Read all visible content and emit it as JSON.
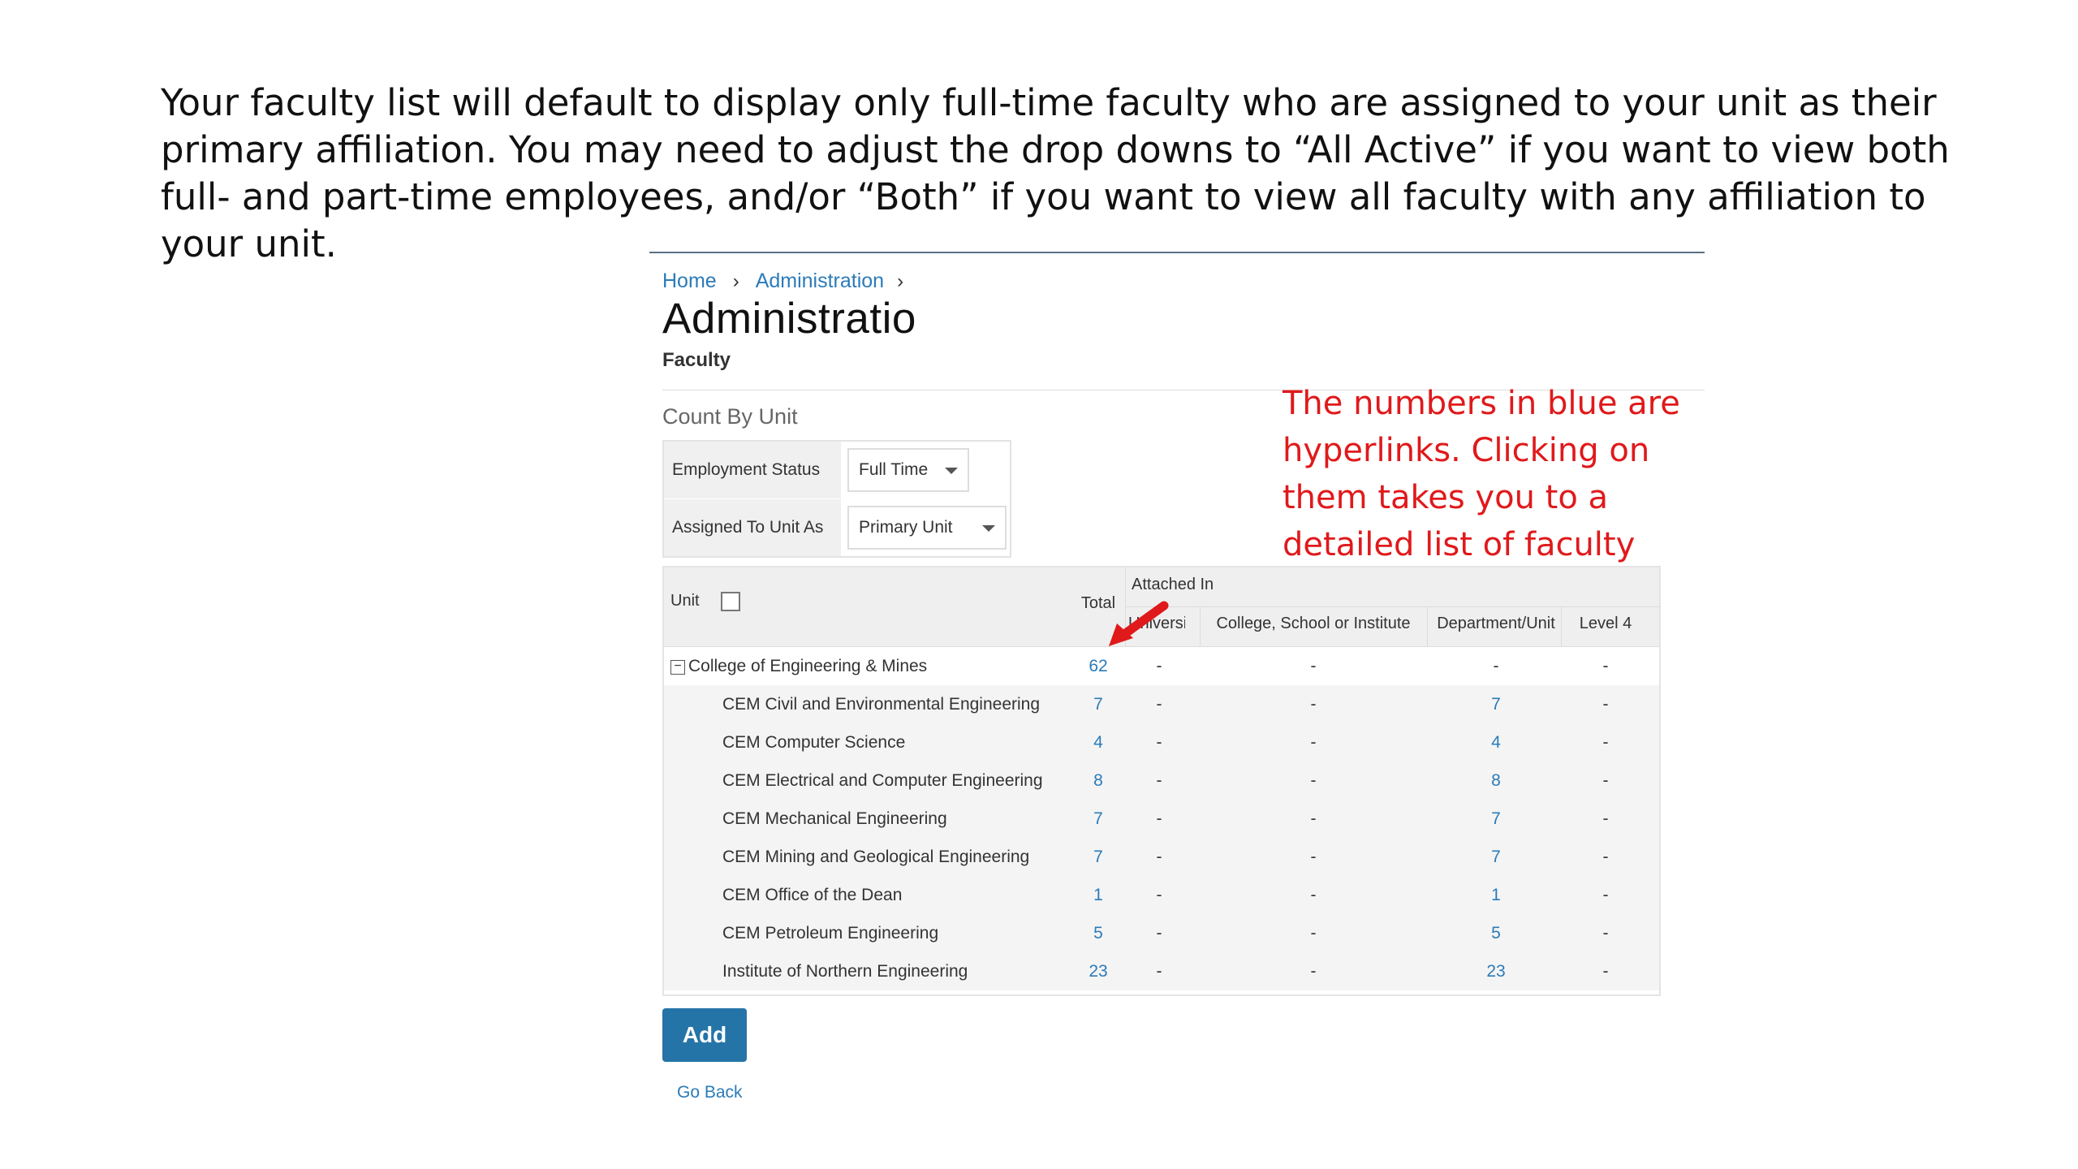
{
  "intro_text": "Your faculty list will default to display only full-time faculty who are assigned to your unit as their primary affiliation.  You may need to adjust the drop downs to “All Active” if you want to view both full- and part-time employees, and/or “Both” if you want to view all faculty with any affiliation to your unit.",
  "breadcrumb": {
    "home": "Home",
    "administration": "Administration",
    "sep": "›"
  },
  "page_title": "Administratio",
  "page_subtitle": "Faculty",
  "count_title": "Count By Unit",
  "filters": {
    "employment_status_label": "Employment Status",
    "employment_status_value": "Full Time",
    "assigned_label": "Assigned To Unit As",
    "assigned_value": "Primary Unit"
  },
  "table": {
    "headers": {
      "unit": "Unit",
      "total": "Total",
      "attached_in": "Attached In",
      "university": "University",
      "college": "College, School or Institute",
      "department": "Department/Unit",
      "level4": "Level 4"
    },
    "parent": {
      "unit": "College of Engineering & Mines",
      "total": "62",
      "university": "-",
      "college": "-",
      "department": "-",
      "level4": "-"
    },
    "rows": [
      {
        "unit": "CEM Civil and Environmental Engineering",
        "total": "7",
        "university": "-",
        "college": "-",
        "department": "7",
        "level4": "-"
      },
      {
        "unit": "CEM Computer Science",
        "total": "4",
        "university": "-",
        "college": "-",
        "department": "4",
        "level4": "-"
      },
      {
        "unit": "CEM Electrical and Computer Engineering",
        "total": "8",
        "university": "-",
        "college": "-",
        "department": "8",
        "level4": "-"
      },
      {
        "unit": "CEM Mechanical Engineering",
        "total": "7",
        "university": "-",
        "college": "-",
        "department": "7",
        "level4": "-"
      },
      {
        "unit": "CEM Mining and Geological Engineering",
        "total": "7",
        "university": "-",
        "college": "-",
        "department": "7",
        "level4": "-"
      },
      {
        "unit": "CEM Office of the Dean",
        "total": "1",
        "university": "-",
        "college": "-",
        "department": "1",
        "level4": "-"
      },
      {
        "unit": "CEM Petroleum Engineering",
        "total": "5",
        "university": "-",
        "college": "-",
        "department": "5",
        "level4": "-"
      },
      {
        "unit": "Institute of Northern Engineering",
        "total": "23",
        "university": "-",
        "college": "-",
        "department": "23",
        "level4": "-"
      }
    ]
  },
  "add_label": "Add",
  "go_back_label": "Go Back",
  "callout_text": "The numbers in blue are hyperlinks. Clicking on them takes you to a detailed list of faculty",
  "colors": {
    "link": "#2b7bb9",
    "button": "#2474a8",
    "callout": "#e0191b"
  },
  "icons": {
    "collapse": "minus-square-icon",
    "arrow": "red-arrow-icon",
    "select": "caret-down-icon"
  }
}
